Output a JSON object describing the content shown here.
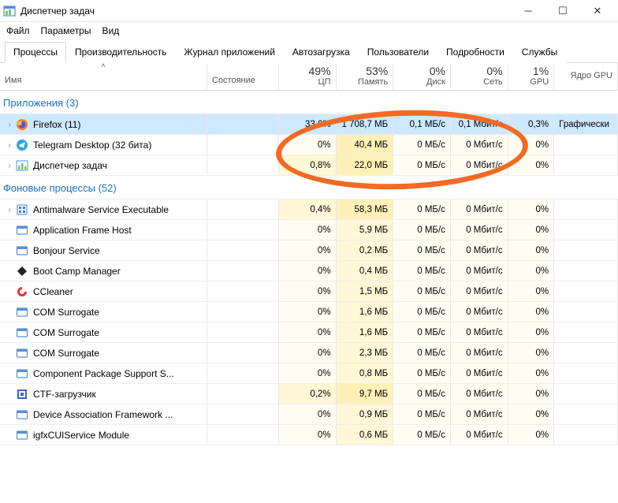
{
  "window": {
    "title": "Диспетчер задач"
  },
  "menu": {
    "file": "Файл",
    "options": "Параметры",
    "view": "Вид"
  },
  "tabs": {
    "processes": "Процессы",
    "performance": "Производительность",
    "app_history": "Журнал приложений",
    "startup": "Автозагрузка",
    "users": "Пользователи",
    "details": "Подробности",
    "services": "Службы"
  },
  "columns": {
    "name": "Имя",
    "state": "Состояние",
    "cpu_pct": "49%",
    "cpu_label": "ЦП",
    "mem_pct": "53%",
    "mem_label": "Память",
    "disk_pct": "0%",
    "disk_label": "Диск",
    "net_pct": "0%",
    "net_label": "Сеть",
    "gpu_pct": "1%",
    "gpu_label": "GPU",
    "gpu_engine": "Ядро GPU"
  },
  "groups": {
    "apps": "Приложения (3)",
    "bg": "Фоновые процессы (52)"
  },
  "rows": [
    {
      "group": "apps",
      "expandable": true,
      "selected": true,
      "name": "Firefox (11)",
      "icon": "firefox",
      "cpu": "33,6%",
      "mem": "1 708,7 МБ",
      "disk": "0,1 МБ/с",
      "net": "0,1 Мбит/с",
      "gpu": "0,3%",
      "eng": "Графически"
    },
    {
      "group": "apps",
      "expandable": true,
      "name": "Telegram Desktop (32 бита)",
      "icon": "telegram",
      "cpu": "0%",
      "mem": "40,4 МБ",
      "disk": "0 МБ/с",
      "net": "0 Мбит/с",
      "gpu": "0%",
      "eng": ""
    },
    {
      "group": "apps",
      "expandable": true,
      "name": "Диспетчер задач",
      "icon": "taskmgr",
      "cpu": "0,8%",
      "mem": "22,0 МБ",
      "disk": "0 МБ/с",
      "net": "0 Мбит/с",
      "gpu": "0%",
      "eng": ""
    },
    {
      "group": "bg",
      "expandable": true,
      "name": "Antimalware Service Executable",
      "icon": "shield",
      "cpu": "0,4%",
      "mem": "58,3 МБ",
      "disk": "0 МБ/с",
      "net": "0 Мбит/с",
      "gpu": "0%",
      "eng": ""
    },
    {
      "group": "bg",
      "expandable": false,
      "name": "Application Frame Host",
      "icon": "generic",
      "cpu": "0%",
      "mem": "5,9 МБ",
      "disk": "0 МБ/с",
      "net": "0 Мбит/с",
      "gpu": "0%",
      "eng": ""
    },
    {
      "group": "bg",
      "expandable": false,
      "name": "Bonjour Service",
      "icon": "generic",
      "cpu": "0%",
      "mem": "0,2 МБ",
      "disk": "0 МБ/с",
      "net": "0 Мбит/с",
      "gpu": "0%",
      "eng": ""
    },
    {
      "group": "bg",
      "expandable": false,
      "name": "Boot Camp Manager",
      "icon": "diamond",
      "cpu": "0%",
      "mem": "0,4 МБ",
      "disk": "0 МБ/с",
      "net": "0 Мбит/с",
      "gpu": "0%",
      "eng": ""
    },
    {
      "group": "bg",
      "expandable": false,
      "name": "CCleaner",
      "icon": "ccleaner",
      "cpu": "0%",
      "mem": "1,5 МБ",
      "disk": "0 МБ/с",
      "net": "0 Мбит/с",
      "gpu": "0%",
      "eng": ""
    },
    {
      "group": "bg",
      "expandable": false,
      "name": "COM Surrogate",
      "icon": "generic",
      "cpu": "0%",
      "mem": "1,6 МБ",
      "disk": "0 МБ/с",
      "net": "0 Мбит/с",
      "gpu": "0%",
      "eng": ""
    },
    {
      "group": "bg",
      "expandable": false,
      "name": "COM Surrogate",
      "icon": "generic",
      "cpu": "0%",
      "mem": "1,6 МБ",
      "disk": "0 МБ/с",
      "net": "0 Мбит/с",
      "gpu": "0%",
      "eng": ""
    },
    {
      "group": "bg",
      "expandable": false,
      "name": "COM Surrogate",
      "icon": "generic",
      "cpu": "0%",
      "mem": "2,3 МБ",
      "disk": "0 МБ/с",
      "net": "0 Мбит/с",
      "gpu": "0%",
      "eng": ""
    },
    {
      "group": "bg",
      "expandable": false,
      "name": "Component Package Support S...",
      "icon": "generic",
      "cpu": "0%",
      "mem": "0,8 МБ",
      "disk": "0 МБ/с",
      "net": "0 Мбит/с",
      "gpu": "0%",
      "eng": ""
    },
    {
      "group": "bg",
      "expandable": false,
      "name": "CTF-загрузчик",
      "icon": "ctf",
      "cpu": "0,2%",
      "mem": "9,7 МБ",
      "disk": "0 МБ/с",
      "net": "0 Мбит/с",
      "gpu": "0%",
      "eng": ""
    },
    {
      "group": "bg",
      "expandable": false,
      "name": "Device Association Framework ...",
      "icon": "generic",
      "cpu": "0%",
      "mem": "0,9 МБ",
      "disk": "0 МБ/с",
      "net": "0 Мбит/с",
      "gpu": "0%",
      "eng": ""
    },
    {
      "group": "bg",
      "expandable": false,
      "name": "igfxCUIService Module",
      "icon": "generic",
      "cpu": "0%",
      "mem": "0,6 МБ",
      "disk": "0 МБ/с",
      "net": "0 Мбит/с",
      "gpu": "0%",
      "eng": ""
    }
  ],
  "heat": {
    "cpu": {
      "33,6%": "heat4",
      "0,8%": "heat1",
      "0,4%": "heat1",
      "0,2%": "heat1",
      "0%": "heat0"
    },
    "mem": {
      "default": "heat1",
      "1 708,7 МБ": "heat3",
      "58,3 МБ": "heat2",
      "40,4 МБ": "heat2",
      "22,0 МБ": "heat2",
      "9,7 МБ": "heat2"
    },
    "zero": "heat0"
  },
  "icons": {
    "firefox": "#ff7b1a",
    "telegram": "#2fa3e0",
    "taskmgr": "#6aa7e8",
    "shield": "#3a7bd5",
    "generic": "#5a8fd6",
    "diamond": "#333",
    "ccleaner": "#d33",
    "ctf": "#3a66c7"
  }
}
